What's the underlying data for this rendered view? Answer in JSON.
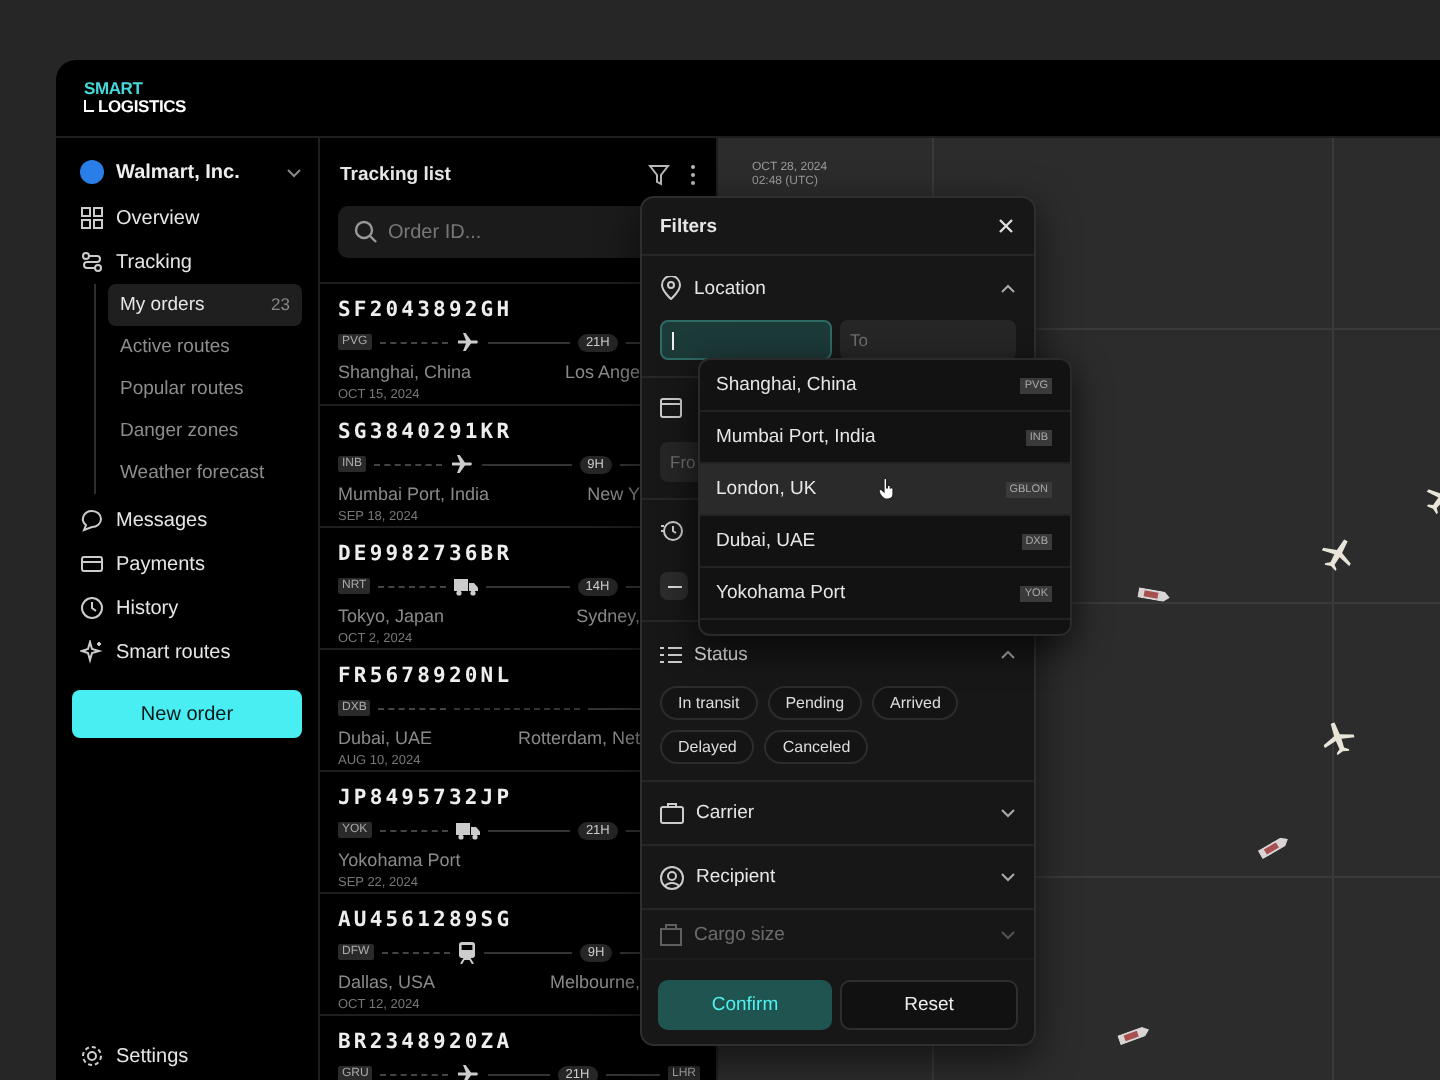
{
  "logo": {
    "line1": "SMART",
    "line2": "LOGISTICS"
  },
  "sidebar": {
    "account": {
      "name": "Walmart, Inc."
    },
    "items": [
      {
        "label": "Overview",
        "selected": false
      },
      {
        "label": "Tracking",
        "selected": false,
        "expanded": true,
        "children": [
          {
            "label": "My orders",
            "count": "23",
            "selected": true
          },
          {
            "label": "Active routes",
            "selected": false
          },
          {
            "label": "Popular routes",
            "selected": false
          },
          {
            "label": "Danger zones",
            "selected": false
          },
          {
            "label": "Weather forecast",
            "selected": false
          }
        ]
      },
      {
        "label": "Messages",
        "selected": false
      },
      {
        "label": "Payments",
        "selected": false
      },
      {
        "label": "History",
        "selected": false
      },
      {
        "label": "Smart routes",
        "selected": false
      }
    ],
    "new_order_button": "New order",
    "settings": "Settings"
  },
  "tracking_list": {
    "title": "Tracking list",
    "search": {
      "placeholder": "Order ID..."
    },
    "orders": [
      {
        "id": "SF2043892GH",
        "origin_code": "PVG",
        "kind": "air",
        "duration": "21H",
        "origin": "Shanghai, China",
        "date": "OCT 15, 2024",
        "destination": "Los Ange"
      },
      {
        "id": "SG3840291KR",
        "origin_code": "INB",
        "kind": "air",
        "duration": "9H",
        "origin": "Mumbai Port, India",
        "date": "SEP 18, 2024",
        "destination": "New Y"
      },
      {
        "id": "DE9982736BR",
        "origin_code": "NRT",
        "kind": "road",
        "duration": "14H",
        "origin": "Tokyo, Japan",
        "date": "OCT 2, 2024",
        "destination": "Sydney,"
      },
      {
        "id": "FR5678920NL",
        "origin_code": "DXB",
        "kind": "plain",
        "origin": "Dubai, UAE",
        "date": "AUG 10, 2024",
        "destination": "Rotterdam, Net"
      },
      {
        "id": "JP8495732JP",
        "origin_code": "YOK",
        "kind": "road",
        "duration": "21H",
        "origin": "Yokohama Port",
        "date": "SEP 22, 2024"
      },
      {
        "id": "AU4561289SG",
        "origin_code": "DFW",
        "kind": "rail",
        "duration": "9H",
        "origin": "Dallas, USA",
        "date": "OCT 12, 2024",
        "destination": "Melbourne,"
      },
      {
        "id": "BR2348920ZA",
        "origin_code": "GRU",
        "kind": "air",
        "duration": "21H",
        "destination_code": "LHR"
      }
    ]
  },
  "map": {
    "timestamp": {
      "date": "OCT 28, 2024",
      "time": "02:48 (UTC)"
    }
  },
  "filters": {
    "title": "Filters",
    "location": {
      "label": "Location",
      "expanded": true,
      "from": {
        "focused": true
      },
      "to": {
        "placeholder": "To"
      }
    },
    "date": {
      "from": {
        "placeholder": "Fro"
      }
    },
    "time": {
      "toggle_on": false
    },
    "status": {
      "label": "Status",
      "expanded": true,
      "chips": [
        {
          "label": "In transit",
          "selected": false
        },
        {
          "label": "Pending",
          "selected": false
        },
        {
          "label": "Arrived",
          "selected": false
        },
        {
          "label": "Delayed",
          "selected": false
        },
        {
          "label": "Canceled",
          "selected": false
        }
      ]
    },
    "sections": [
      {
        "label": "Carrier",
        "expanded": false,
        "faded": false
      },
      {
        "label": "Recipient",
        "expanded": false,
        "faded": false
      },
      {
        "label": "Cargo size",
        "expanded": false,
        "faded": true
      }
    ],
    "confirm_button": "Confirm",
    "reset_button": "Reset"
  },
  "suggestions": [
    {
      "name": "Shanghai, China",
      "code": "PVG",
      "highlighted": false
    },
    {
      "name": "Mumbai Port, India",
      "code": "INB",
      "highlighted": false
    },
    {
      "name": "London, UK",
      "code": "GBLON",
      "highlighted": true
    },
    {
      "name": "Dubai, UAE",
      "code": "DXB",
      "highlighted": false
    },
    {
      "name": "Yokohama Port",
      "code": "YOK",
      "highlighted": false
    }
  ]
}
